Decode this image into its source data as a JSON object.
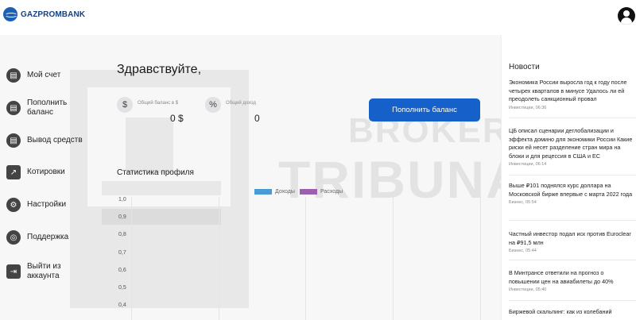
{
  "brand": {
    "name": "GAZPROMBANK",
    "color": "#1d5fb4"
  },
  "header": {
    "avatar_icon": "user-account-icon"
  },
  "sidebar": {
    "items": [
      {
        "label": "Мой счет",
        "icon": "wallet-icon"
      },
      {
        "label": "Пополнить баланс",
        "icon": "deposit-icon"
      },
      {
        "label": "Вывод средств",
        "icon": "withdraw-icon"
      },
      {
        "label": "Котировки",
        "icon": "chart-line-icon"
      },
      {
        "label": "Настройки",
        "icon": "gear-icon"
      },
      {
        "label": "Поддержка",
        "icon": "lifebuoy-icon"
      },
      {
        "label": "Выйти из аккаунта",
        "icon": "logout-icon"
      }
    ]
  },
  "main": {
    "greeting": "Здравствуйте,",
    "balance": {
      "symbol": "$",
      "label": "Общий баланс в $",
      "value": "0 $"
    },
    "income": {
      "symbol": "%",
      "label": "Общий доход",
      "value": "0"
    },
    "topup_button": "Пополнить баланс",
    "accent_color": "#1660c9"
  },
  "watermark": {
    "line1": "BROKER",
    "line2": "TRIBUNAL"
  },
  "chart_data": {
    "type": "bar",
    "title": "Статистика профиля",
    "series": [
      {
        "name": "Доходы",
        "color": "#4a9ad4",
        "values": []
      },
      {
        "name": "Расходы",
        "color": "#9b5fb0",
        "values": []
      }
    ],
    "yticks": [
      "1,0",
      "0,9",
      "0,8",
      "0,7",
      "0,6",
      "0,5",
      "0,4"
    ],
    "grid": true,
    "legend": "top"
  },
  "news": {
    "title": "Новости",
    "items": [
      {
        "headline": "Экономика России выросла год к году после четырех кварталов в минусе Удалось ли ей преодолеть санкционный провал",
        "meta": "Инвестиции, 06:36"
      },
      {
        "headline": "ЦБ описал сценарии деглобализации и эффекта домино для экономики России Какие риски ей несет разделение стран мира на блоки и для рецессия в США и ЕС",
        "meta": "Инвестиции, 06:14"
      },
      {
        "headline": "Выше ₽101 поднялся курс доллара на Московской бирже впервые с марта 2022 года",
        "meta": "Бизнес, 05:54"
      },
      {
        "headline": "Частный инвестор подал иск против Euroclear на ₽91,5 млн",
        "meta": "Бизнес, 05:44"
      },
      {
        "headline": "В Минтрансе ответили на прогноз о повышении цен на авиабилеты до 40%",
        "meta": "Инвестиции, 05:40"
      },
      {
        "headline": "Биржевой скальпинг: как из колебаний",
        "meta": ""
      }
    ]
  }
}
